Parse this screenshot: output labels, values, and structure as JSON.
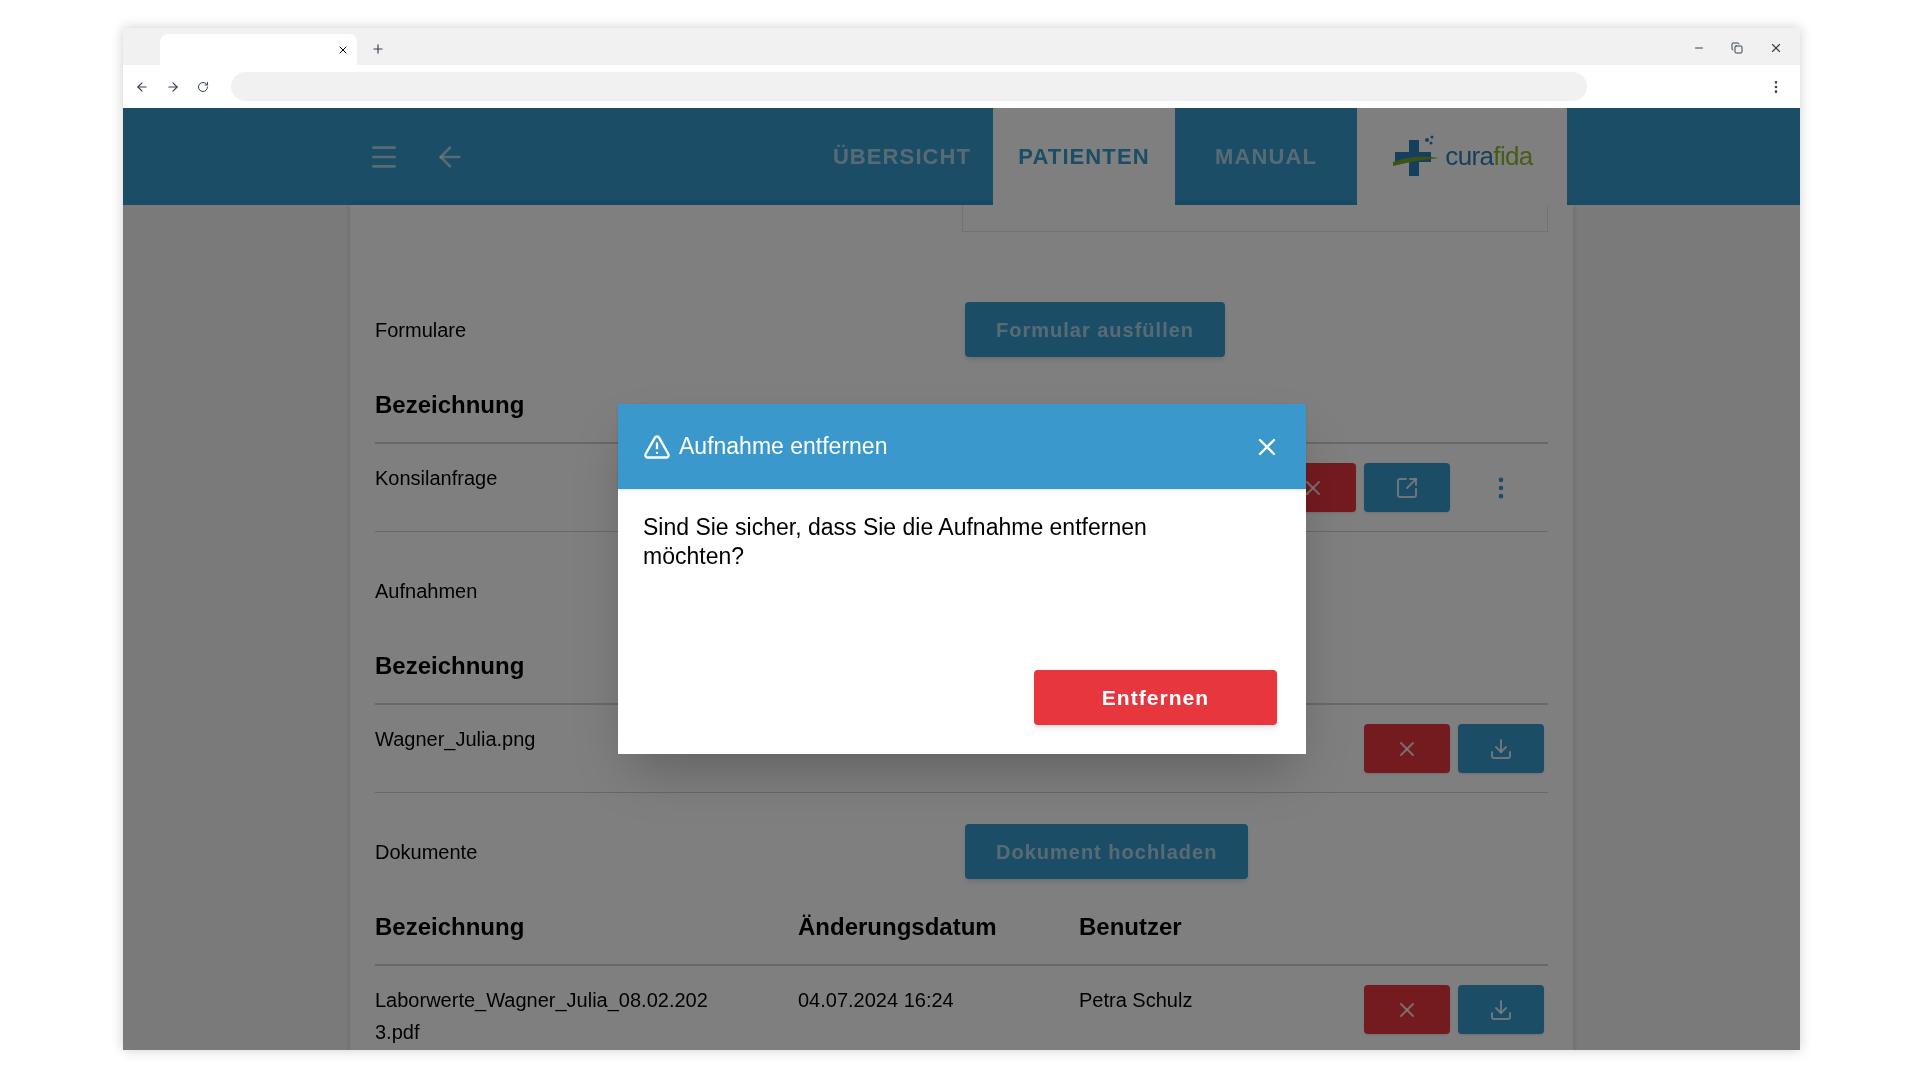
{
  "nav": {
    "tabs": [
      {
        "label": "ÜBERSICHT",
        "selected": false
      },
      {
        "label": "PATIENTEN",
        "selected": true
      },
      {
        "label": "MANUAL",
        "selected": false
      }
    ],
    "logo": {
      "first": "cura",
      "second": "fida"
    }
  },
  "sections": [
    {
      "title": "Formulare",
      "action": "Formular ausfüllen",
      "columns": [
        "Bezeichnung"
      ],
      "rows": [
        {
          "cells": [
            "Konsilanfrage"
          ],
          "actions": [
            {
              "kind": "delete"
            },
            {
              "kind": "open"
            },
            {
              "kind": "more"
            }
          ]
        }
      ]
    },
    {
      "title": "Aufnahmen",
      "columns": [
        "Bezeichnung"
      ],
      "rows": [
        {
          "cells": [
            "Wagner_Julia.png"
          ],
          "actions": [
            {
              "kind": "delete"
            },
            {
              "kind": "download"
            }
          ]
        }
      ]
    },
    {
      "title": "Dokumente",
      "action": "Dokument hochladen",
      "columns": [
        "Bezeichnung",
        "Änderungsdatum",
        "Benutzer"
      ],
      "rows": [
        {
          "cells": [
            "Laborwerte_Wagner_Julia_08.02.2023.pdf",
            "04.07.2024 16:24",
            "Petra Schulz"
          ],
          "actions": [
            {
              "kind": "delete"
            },
            {
              "kind": "download"
            }
          ]
        }
      ]
    }
  ],
  "dialog": {
    "title": "Aufnahme entfernen",
    "message": "Sind Sie sicher, dass Sie die Aufnahme entfernen möchten?",
    "confirm": "Entfernen"
  }
}
